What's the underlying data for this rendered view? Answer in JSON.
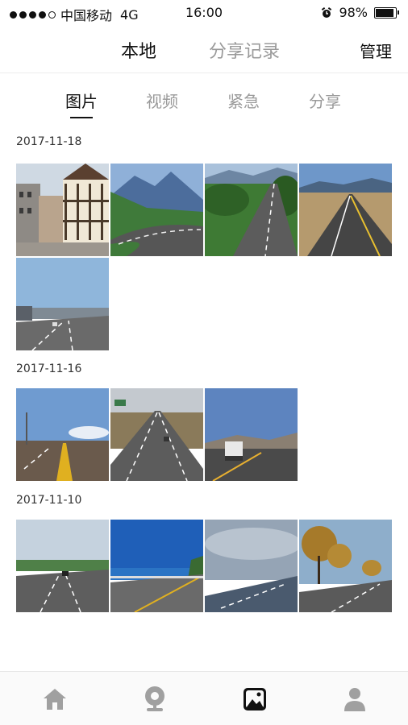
{
  "status_bar": {
    "carrier": "中国移动",
    "network": "4G",
    "time": "16:00",
    "battery": "98%",
    "battery_level": 0.98
  },
  "header": {
    "tabs": [
      {
        "label": "本地",
        "active": true
      },
      {
        "label": "分享记录",
        "active": false
      }
    ],
    "manage": "管理"
  },
  "sub_tabs": [
    {
      "label": "图片",
      "active": true
    },
    {
      "label": "视频",
      "active": false
    },
    {
      "label": "紧急",
      "active": false
    },
    {
      "label": "分享",
      "active": false
    }
  ],
  "sections": [
    {
      "date": "2017-11-18",
      "photo_count": 5
    },
    {
      "date": "2017-11-16",
      "photo_count": 3
    },
    {
      "date": "2017-11-10",
      "photo_count": 4
    }
  ],
  "bottom_nav": [
    {
      "icon": "home-icon",
      "active": false
    },
    {
      "icon": "camera-icon",
      "active": false
    },
    {
      "icon": "gallery-icon",
      "active": true
    },
    {
      "icon": "profile-icon",
      "active": false
    }
  ],
  "colors": {
    "active": "#111111",
    "inactive": "#9a9a9a",
    "nav_inactive": "#a0a0a0"
  }
}
